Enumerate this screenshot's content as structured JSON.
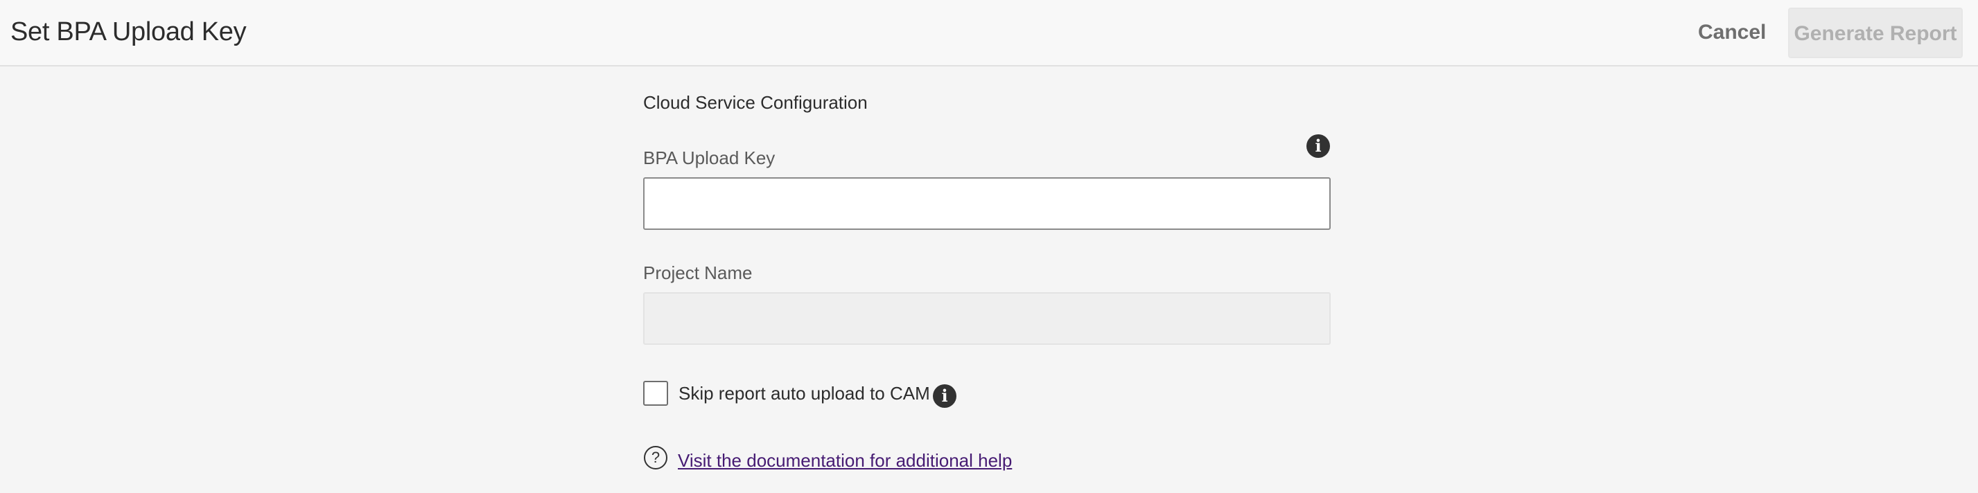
{
  "header": {
    "title": "Set BPA Upload Key",
    "cancel_label": "Cancel",
    "generate_label": "Generate Report"
  },
  "form": {
    "section_title": "Cloud Service Configuration",
    "upload_key": {
      "label": "BPA Upload Key",
      "value": "",
      "info_icon": "info-icon"
    },
    "project_name": {
      "label": "Project Name",
      "value": "",
      "disabled": true
    },
    "skip_upload": {
      "label": "Skip report auto upload to CAM",
      "checked": false,
      "info_icon": "info-icon"
    },
    "help": {
      "icon": "question-circle-icon",
      "glyph": "?",
      "info_glyph": "i",
      "link_text": "Visit the documentation for additional help"
    }
  },
  "colors": {
    "background": "#f5f5f5",
    "header_bg": "#f8f8f8",
    "link": "#461b73",
    "icon": "#323232",
    "primary_disabled_text": "#b0b0b0"
  }
}
